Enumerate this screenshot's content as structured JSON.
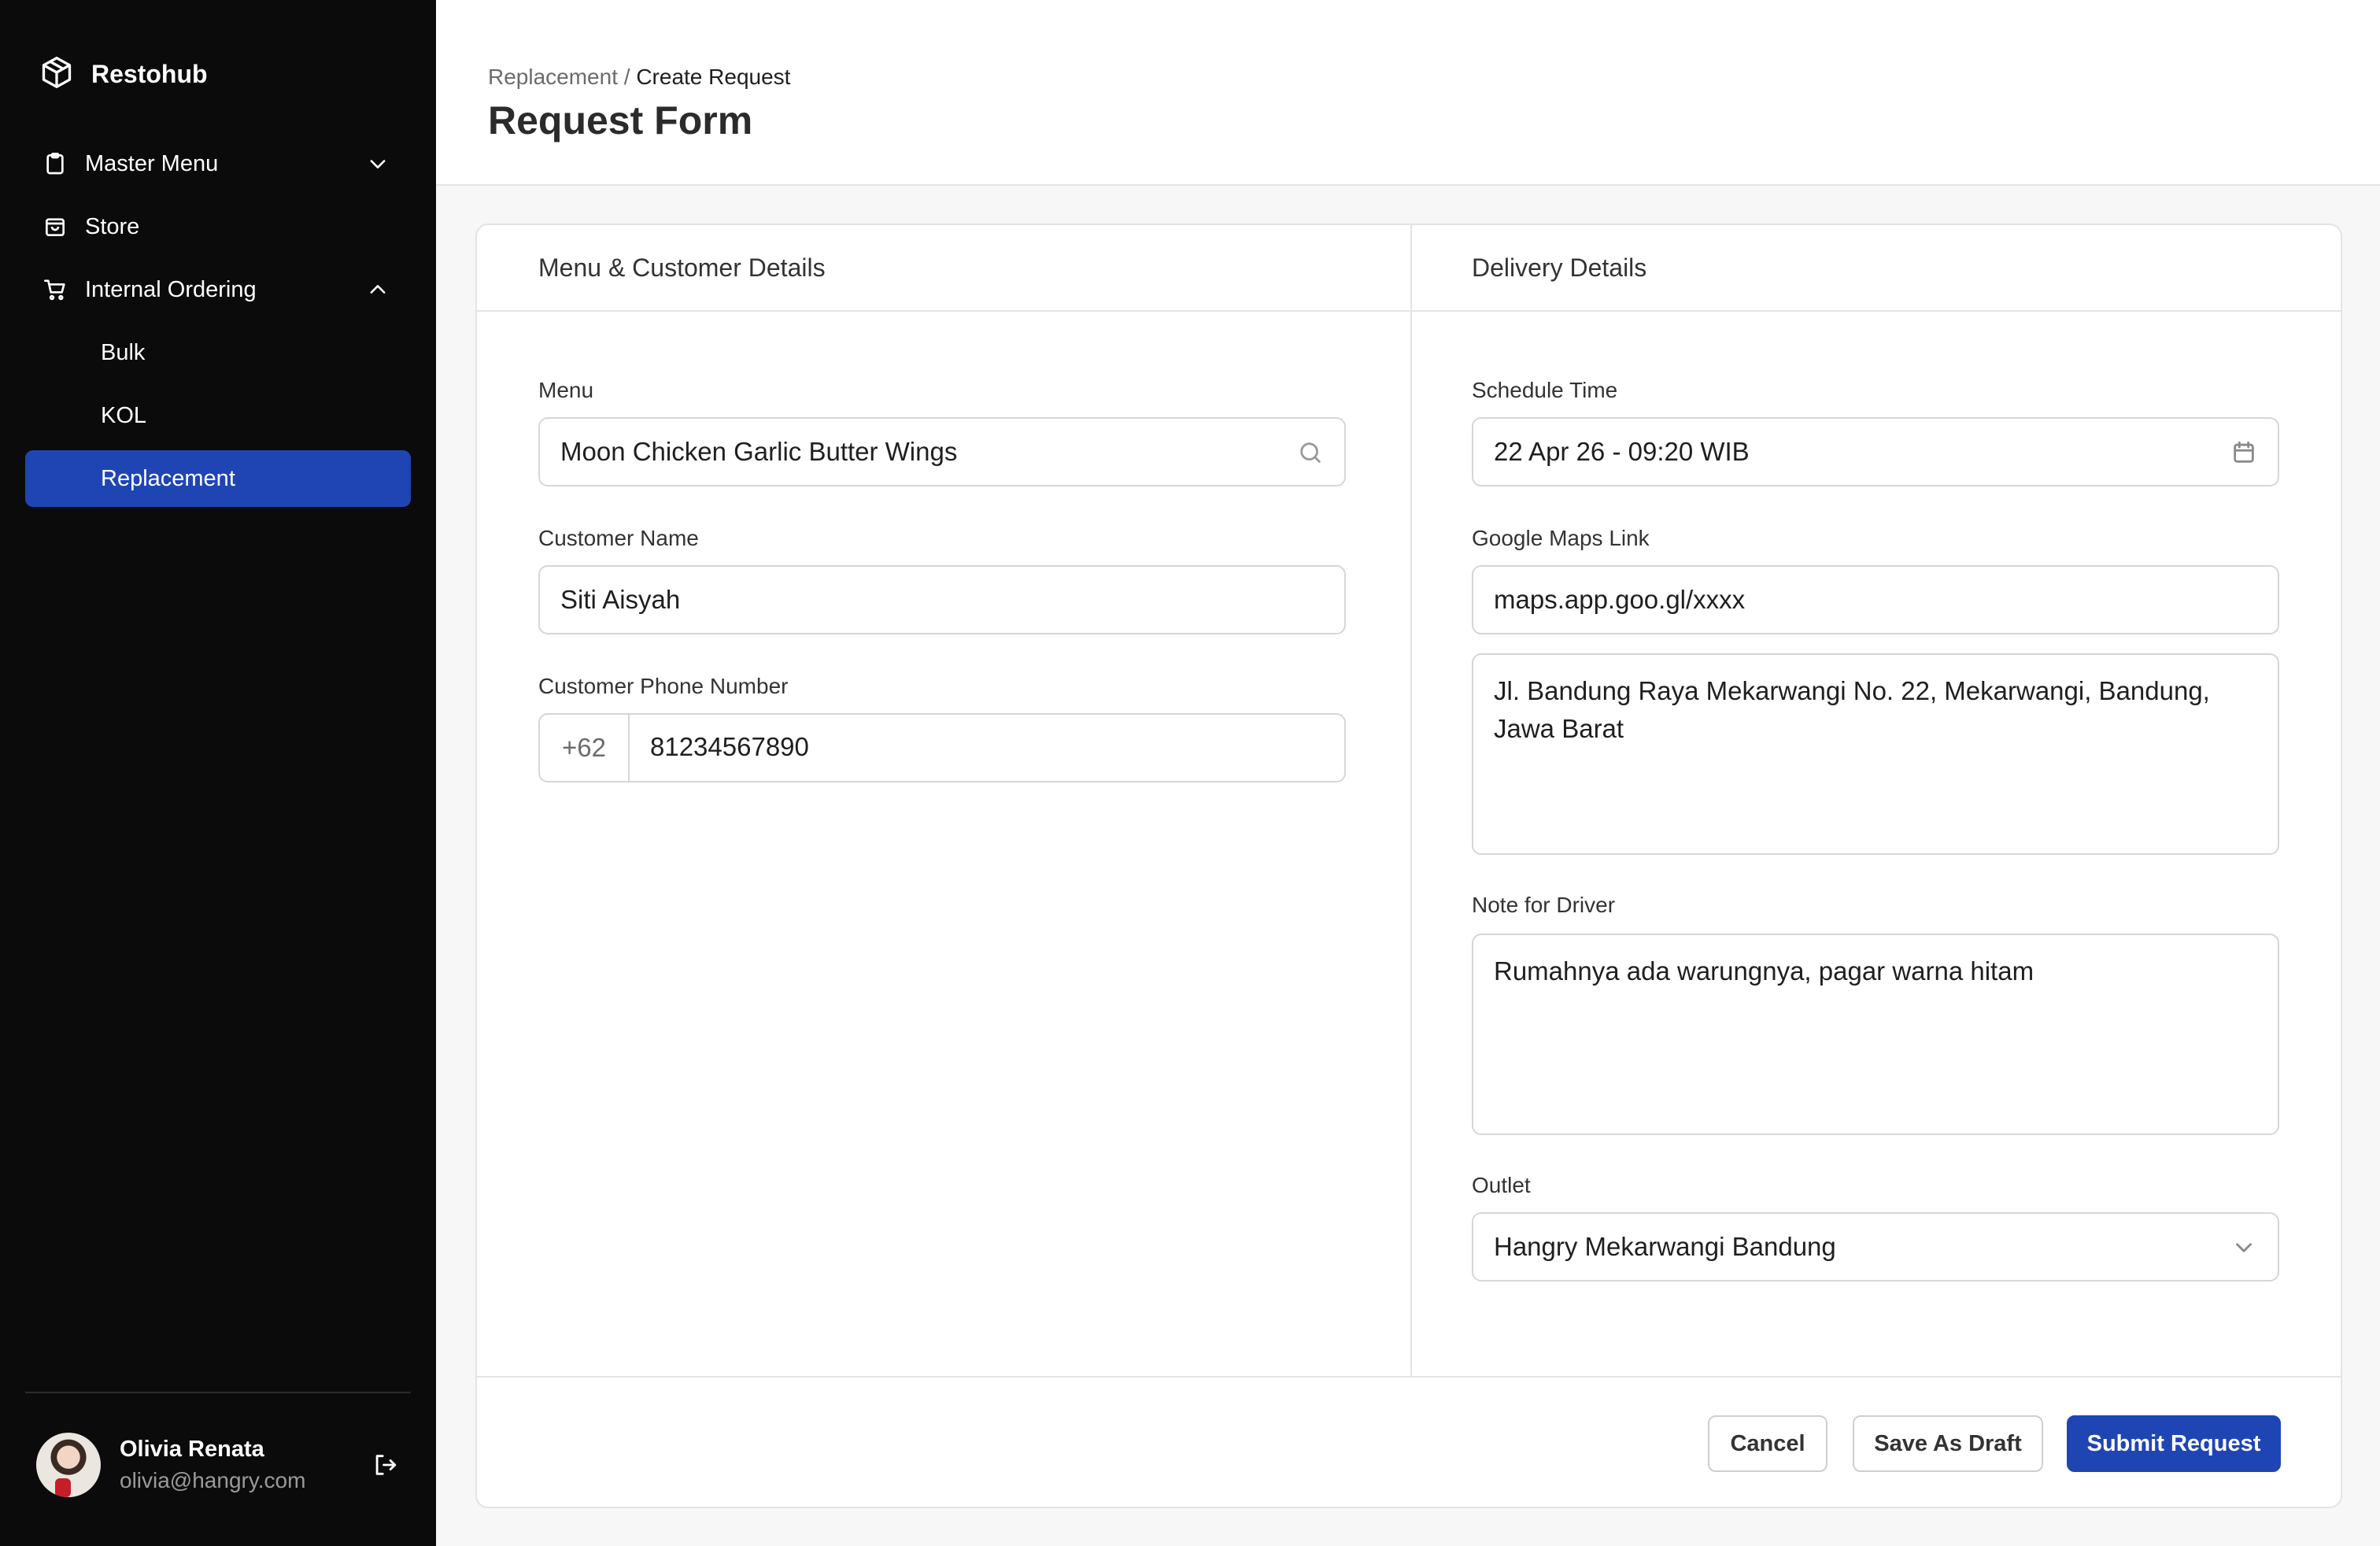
{
  "sidebar": {
    "brand": "Restohub",
    "items": [
      {
        "label": "Master Menu"
      },
      {
        "label": "Store"
      },
      {
        "label": "Internal Ordering"
      }
    ],
    "sub_items": [
      {
        "label": "Bulk"
      },
      {
        "label": "KOL"
      },
      {
        "label": "Replacement",
        "active": true
      }
    ],
    "user": {
      "name": "Olivia Renata",
      "email": "olivia@hangry.com"
    }
  },
  "header": {
    "breadcrumb_parent": "Replacement",
    "breadcrumb_separator": "/",
    "breadcrumb_current": "Create Request",
    "title": "Request Form"
  },
  "form": {
    "left_section_title": "Menu & Customer Details",
    "right_section_title": "Delivery Details",
    "menu": {
      "label": "Menu",
      "value": "Moon Chicken Garlic Butter Wings"
    },
    "customer_name": {
      "label": "Customer Name",
      "value": "Siti Aisyah"
    },
    "customer_phone": {
      "label": "Customer Phone Number",
      "prefix": "+62",
      "value": "81234567890"
    },
    "schedule_time": {
      "label": "Schedule Time",
      "value": "22 Apr 26 - 09:20 WIB"
    },
    "maps_link": {
      "label": "Google Maps Link",
      "value": "maps.app.goo.gl/xxxx"
    },
    "address": {
      "value": "Jl. Bandung Raya Mekarwangi No. 22, Mekarwangi, Bandung, Jawa Barat"
    },
    "driver_note": {
      "label": "Note for Driver",
      "value": "Rumahnya ada warungnya, pagar warna hitam"
    },
    "outlet": {
      "label": "Outlet",
      "value": "Hangry Mekarwangi Bandung"
    }
  },
  "actions": {
    "cancel": "Cancel",
    "save_draft": "Save As Draft",
    "submit": "Submit Request"
  },
  "colors": {
    "sidebar_bg": "#0b0b0b",
    "accent": "#1f45b5"
  }
}
